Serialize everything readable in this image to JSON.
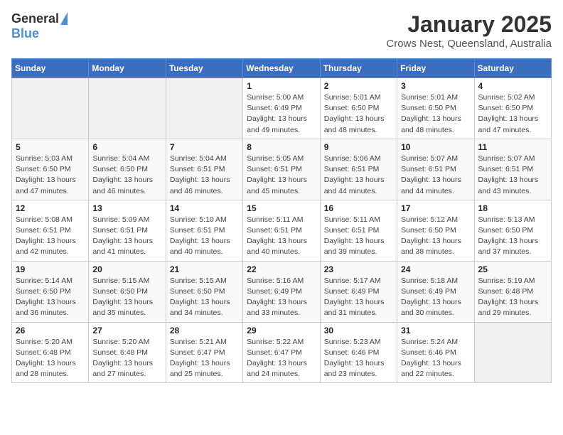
{
  "header": {
    "logo_general": "General",
    "logo_blue": "Blue",
    "month": "January 2025",
    "location": "Crows Nest, Queensland, Australia"
  },
  "weekdays": [
    "Sunday",
    "Monday",
    "Tuesday",
    "Wednesday",
    "Thursday",
    "Friday",
    "Saturday"
  ],
  "weeks": [
    [
      {
        "day": "",
        "info": ""
      },
      {
        "day": "",
        "info": ""
      },
      {
        "day": "",
        "info": ""
      },
      {
        "day": "1",
        "info": "Sunrise: 5:00 AM\nSunset: 6:49 PM\nDaylight: 13 hours\nand 49 minutes."
      },
      {
        "day": "2",
        "info": "Sunrise: 5:01 AM\nSunset: 6:50 PM\nDaylight: 13 hours\nand 48 minutes."
      },
      {
        "day": "3",
        "info": "Sunrise: 5:01 AM\nSunset: 6:50 PM\nDaylight: 13 hours\nand 48 minutes."
      },
      {
        "day": "4",
        "info": "Sunrise: 5:02 AM\nSunset: 6:50 PM\nDaylight: 13 hours\nand 47 minutes."
      }
    ],
    [
      {
        "day": "5",
        "info": "Sunrise: 5:03 AM\nSunset: 6:50 PM\nDaylight: 13 hours\nand 47 minutes."
      },
      {
        "day": "6",
        "info": "Sunrise: 5:04 AM\nSunset: 6:50 PM\nDaylight: 13 hours\nand 46 minutes."
      },
      {
        "day": "7",
        "info": "Sunrise: 5:04 AM\nSunset: 6:51 PM\nDaylight: 13 hours\nand 46 minutes."
      },
      {
        "day": "8",
        "info": "Sunrise: 5:05 AM\nSunset: 6:51 PM\nDaylight: 13 hours\nand 45 minutes."
      },
      {
        "day": "9",
        "info": "Sunrise: 5:06 AM\nSunset: 6:51 PM\nDaylight: 13 hours\nand 44 minutes."
      },
      {
        "day": "10",
        "info": "Sunrise: 5:07 AM\nSunset: 6:51 PM\nDaylight: 13 hours\nand 44 minutes."
      },
      {
        "day": "11",
        "info": "Sunrise: 5:07 AM\nSunset: 6:51 PM\nDaylight: 13 hours\nand 43 minutes."
      }
    ],
    [
      {
        "day": "12",
        "info": "Sunrise: 5:08 AM\nSunset: 6:51 PM\nDaylight: 13 hours\nand 42 minutes."
      },
      {
        "day": "13",
        "info": "Sunrise: 5:09 AM\nSunset: 6:51 PM\nDaylight: 13 hours\nand 41 minutes."
      },
      {
        "day": "14",
        "info": "Sunrise: 5:10 AM\nSunset: 6:51 PM\nDaylight: 13 hours\nand 40 minutes."
      },
      {
        "day": "15",
        "info": "Sunrise: 5:11 AM\nSunset: 6:51 PM\nDaylight: 13 hours\nand 40 minutes."
      },
      {
        "day": "16",
        "info": "Sunrise: 5:11 AM\nSunset: 6:51 PM\nDaylight: 13 hours\nand 39 minutes."
      },
      {
        "day": "17",
        "info": "Sunrise: 5:12 AM\nSunset: 6:50 PM\nDaylight: 13 hours\nand 38 minutes."
      },
      {
        "day": "18",
        "info": "Sunrise: 5:13 AM\nSunset: 6:50 PM\nDaylight: 13 hours\nand 37 minutes."
      }
    ],
    [
      {
        "day": "19",
        "info": "Sunrise: 5:14 AM\nSunset: 6:50 PM\nDaylight: 13 hours\nand 36 minutes."
      },
      {
        "day": "20",
        "info": "Sunrise: 5:15 AM\nSunset: 6:50 PM\nDaylight: 13 hours\nand 35 minutes."
      },
      {
        "day": "21",
        "info": "Sunrise: 5:15 AM\nSunset: 6:50 PM\nDaylight: 13 hours\nand 34 minutes."
      },
      {
        "day": "22",
        "info": "Sunrise: 5:16 AM\nSunset: 6:49 PM\nDaylight: 13 hours\nand 33 minutes."
      },
      {
        "day": "23",
        "info": "Sunrise: 5:17 AM\nSunset: 6:49 PM\nDaylight: 13 hours\nand 31 minutes."
      },
      {
        "day": "24",
        "info": "Sunrise: 5:18 AM\nSunset: 6:49 PM\nDaylight: 13 hours\nand 30 minutes."
      },
      {
        "day": "25",
        "info": "Sunrise: 5:19 AM\nSunset: 6:48 PM\nDaylight: 13 hours\nand 29 minutes."
      }
    ],
    [
      {
        "day": "26",
        "info": "Sunrise: 5:20 AM\nSunset: 6:48 PM\nDaylight: 13 hours\nand 28 minutes."
      },
      {
        "day": "27",
        "info": "Sunrise: 5:20 AM\nSunset: 6:48 PM\nDaylight: 13 hours\nand 27 minutes."
      },
      {
        "day": "28",
        "info": "Sunrise: 5:21 AM\nSunset: 6:47 PM\nDaylight: 13 hours\nand 25 minutes."
      },
      {
        "day": "29",
        "info": "Sunrise: 5:22 AM\nSunset: 6:47 PM\nDaylight: 13 hours\nand 24 minutes."
      },
      {
        "day": "30",
        "info": "Sunrise: 5:23 AM\nSunset: 6:46 PM\nDaylight: 13 hours\nand 23 minutes."
      },
      {
        "day": "31",
        "info": "Sunrise: 5:24 AM\nSunset: 6:46 PM\nDaylight: 13 hours\nand 22 minutes."
      },
      {
        "day": "",
        "info": ""
      }
    ]
  ]
}
